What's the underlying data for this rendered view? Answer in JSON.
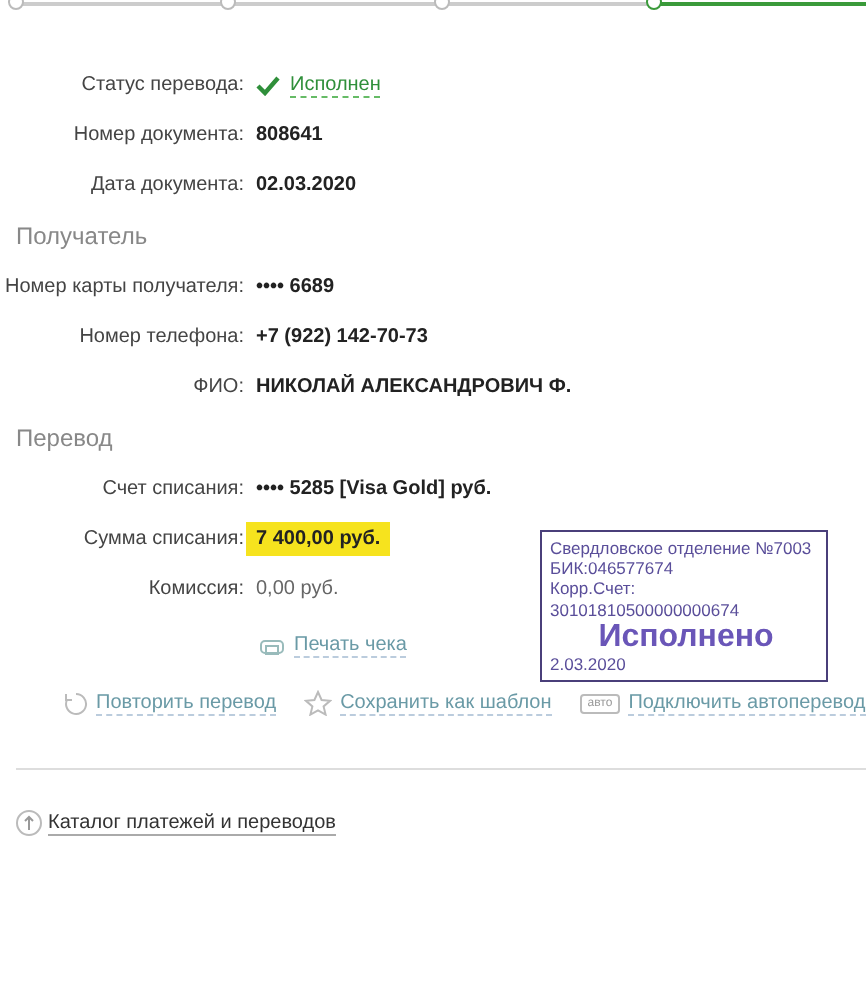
{
  "steps": [
    {
      "selected": false
    },
    {
      "selected": false
    },
    {
      "selected": false
    },
    {
      "selected": true
    }
  ],
  "status": {
    "label": "Статус перевода:",
    "value": "Исполнен"
  },
  "document_fields": [
    {
      "label": "Номер документа:",
      "value": "808641"
    },
    {
      "label": "Дата документа:",
      "value": "02.03.2020"
    }
  ],
  "sections": [
    {
      "title": "Получатель",
      "fields": [
        {
          "label": "Номер карты получателя:",
          "value": "•••• 6689",
          "kind": "plain"
        },
        {
          "label": "Номер телефона:",
          "value": "+7 (922) 142-70-73",
          "kind": "plain"
        },
        {
          "label": "ФИО:",
          "value": "НИКОЛАЙ АЛЕКСАНДРОВИЧ Ф.",
          "kind": "plain"
        }
      ]
    },
    {
      "title": "Перевод",
      "fields": [
        {
          "label": "Счет списания:",
          "value": "•••• 5285  [Visa Gold]  руб.",
          "kind": "plain"
        },
        {
          "label": "Сумма списания:",
          "value": "7 400,00  руб.",
          "kind": "highlight"
        },
        {
          "label": "Комиссия:",
          "value": "0,00 руб.",
          "kind": "light"
        }
      ]
    }
  ],
  "stamp": {
    "lines": [
      "Свердловское отделение №7003",
      "БИК:046577674",
      "Корр.Счет: 30101810500000000674"
    ],
    "status": "Исполнено",
    "date": "2.03.2020"
  },
  "print_link": "Печать чека",
  "actions": [
    {
      "kind": "repeat",
      "label": "Повторить перевод"
    },
    {
      "kind": "template",
      "label": "Сохранить как шаблон"
    },
    {
      "kind": "auto",
      "badge": "авто",
      "label": "Подключить автоперевод"
    }
  ],
  "catalog_link": "Каталог платежей и переводов"
}
